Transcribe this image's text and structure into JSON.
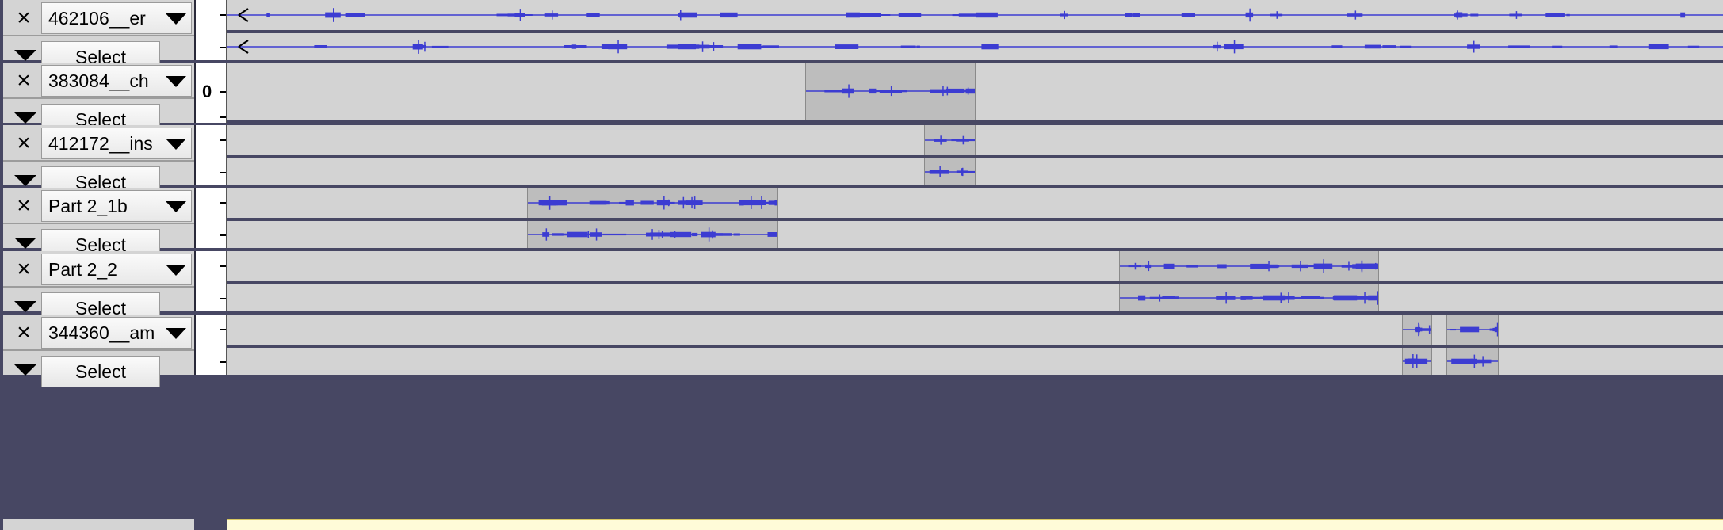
{
  "tracks": [
    {
      "name": "462106__er",
      "select_label": "Select",
      "ruler_label": "",
      "clips": [
        [
          0,
          1
        ]
      ],
      "close_icon": "×",
      "menu_icon": "dropdown-triangle"
    },
    {
      "name": "383084__ch",
      "select_label": "Select",
      "ruler_label": "0",
      "clips": [
        [
          0.3863,
          0.499
        ]
      ],
      "close_icon": "×",
      "menu_icon": "dropdown-triangle"
    },
    {
      "name": "412172__ins",
      "select_label": "Select",
      "ruler_label": "",
      "clips": [
        [
          0.4657,
          0.499
        ]
      ],
      "close_icon": "×",
      "menu_icon": "dropdown-triangle"
    },
    {
      "name": "Part 2_1b",
      "select_label": "Select",
      "ruler_label": "",
      "clips": [
        [
          0.2004,
          0.367
        ]
      ],
      "close_icon": "×",
      "menu_icon": "dropdown-triangle"
    },
    {
      "name": "Part 2_2",
      "select_label": "Select",
      "ruler_label": "",
      "clips": [
        [
          0.5961,
          0.7688
        ]
      ],
      "close_icon": "×",
      "menu_icon": "dropdown-triangle"
    },
    {
      "name": "344360__am",
      "select_label": "Select",
      "ruler_label": "",
      "clips": [
        [
          0.7855,
          0.8042
        ],
        [
          0.8148,
          0.8488
        ]
      ],
      "close_icon": "×",
      "menu_icon": "dropdown-triangle"
    }
  ],
  "colors": {
    "waveform": "#3c3cd2",
    "background": "#474763",
    "lane": "#d3d3d3",
    "clip": "#bdbdbd"
  }
}
